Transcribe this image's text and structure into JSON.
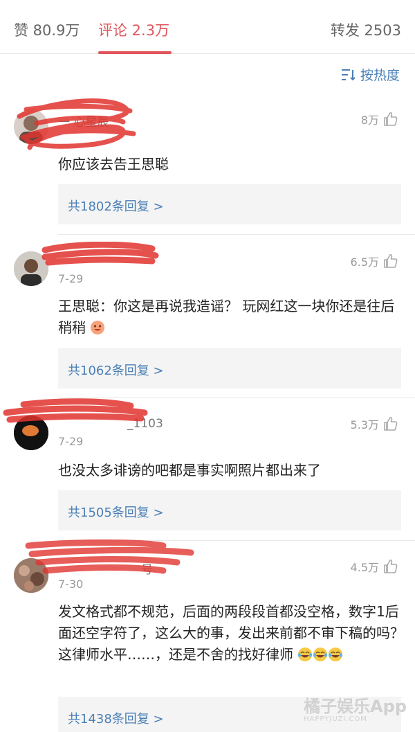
{
  "tabs": {
    "likes": "赞 80.9万",
    "comments": "评论 2.3万",
    "reposts": "转发 2503"
  },
  "sort_label": "按热度",
  "colors": {
    "accent": "#e2545b",
    "link": "#4a7fb5",
    "redaction": "#e0342f"
  },
  "comments": [
    {
      "username": "一 心星辰",
      "date": "",
      "likes": "8万",
      "text": "你应该去告王思聪",
      "replies": "共1802条回复 >"
    },
    {
      "username": "",
      "date": "7-29",
      "likes": "6.5万",
      "text": "王思聪：你这是再说我造谣？ 玩网红这一块你还是往后稍稍",
      "replies": "共1062条回复 >"
    },
    {
      "username": "_1103",
      "date": "7-29",
      "likes": "5.3万",
      "text": "也没太多诽谤的吧都是事实啊照片都出来了",
      "replies": "共1505条回复 >"
    },
    {
      "username": "号",
      "date": "7-30",
      "likes": "4.5万",
      "text": "发文格式都不规范，后面的两段段首都没空格，数字1后面还空字符了，这么大的事，发出来前都不审下稿的吗？这律师水平……，还是不舍的找好律师",
      "replies": "共1438条回复 >"
    }
  ],
  "watermark": {
    "main": "橘子娱乐App",
    "sub": "HAPPYJUZI.COM"
  }
}
